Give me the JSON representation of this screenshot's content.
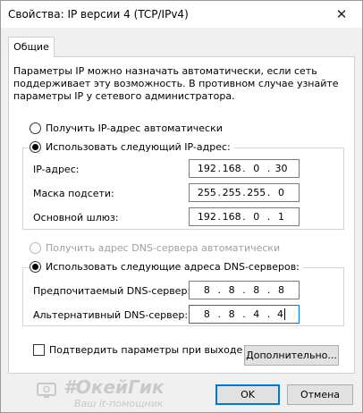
{
  "window": {
    "title": "Свойства: IP версии 4 (TCP/IPv4)",
    "close_glyph": "✕"
  },
  "tabs": [
    {
      "label": "Общие",
      "active": true
    }
  ],
  "description": "Параметры IP можно назначать автоматически, если сеть поддерживает эту возможность. В противном случае узнайте параметры IP у сетевого администратора.",
  "ip_mode": {
    "auto_label": "Получить IP-адрес автоматически",
    "auto_selected": false,
    "manual_label": "Использовать следующий IP-адрес:",
    "manual_selected": true
  },
  "ip_fields": {
    "ip": {
      "label": "IP-адрес:",
      "octets": [
        "192",
        "168",
        "0",
        "30"
      ]
    },
    "mask": {
      "label": "Маска подсети:",
      "octets": [
        "255",
        "255",
        "255",
        "0"
      ]
    },
    "gateway": {
      "label": "Основной шлюз:",
      "octets": [
        "192",
        "168",
        "0",
        "1"
      ]
    }
  },
  "dns_mode": {
    "auto_label": "Получить адрес DNS-сервера автоматически",
    "auto_selected": false,
    "auto_disabled": true,
    "manual_label": "Использовать следующие адреса DNS-серверов:",
    "manual_selected": true
  },
  "dns_fields": {
    "preferred": {
      "label": "Предпочитаемый DNS-сервер:",
      "octets": [
        "8",
        "8",
        "8",
        "8"
      ]
    },
    "alternate": {
      "label": "Альтернативный DNS-сервер:",
      "octets": [
        "8",
        "8",
        "4",
        "4"
      ]
    }
  },
  "validate_on_exit": {
    "label": "Подтвердить параметры при выходе",
    "checked": false
  },
  "buttons": {
    "advanced": "Дополнительно...",
    "ok": "OK",
    "cancel": "Отмена"
  },
  "watermark": {
    "title": "#ОкейГик",
    "subtitle": "Ваш it-помощник"
  },
  "colors": {
    "focus_border": "#0078d7",
    "disabled_text": "#a0a0a0"
  }
}
